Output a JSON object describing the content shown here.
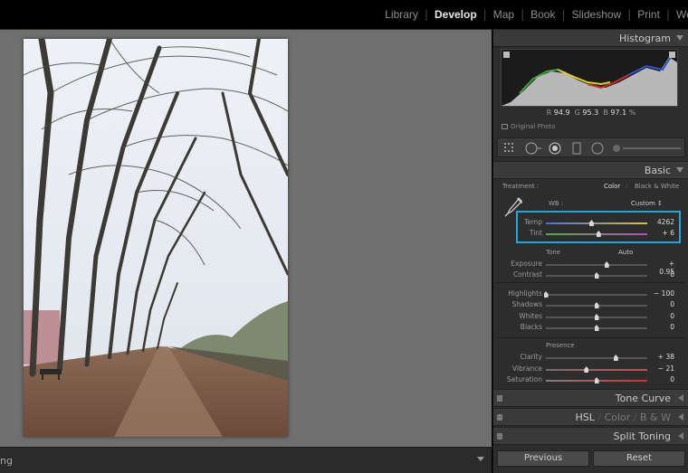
{
  "modules": [
    {
      "label": "Library",
      "active": false
    },
    {
      "label": "Develop",
      "active": true
    },
    {
      "label": "Map",
      "active": false
    },
    {
      "label": "Book",
      "active": false
    },
    {
      "label": "Slideshow",
      "active": false
    },
    {
      "label": "Print",
      "active": false
    },
    {
      "label": "Web",
      "active": false
    }
  ],
  "bottombar": {
    "label": "ng"
  },
  "histogram": {
    "title": "Histogram",
    "r_label": "R",
    "r_value": "94.9",
    "g_label": "G",
    "g_value": "95.3",
    "b_label": "B",
    "b_value": "97.1",
    "unit": "%",
    "original_photo_label": "Original Photo"
  },
  "basic": {
    "title": "Basic",
    "treatment_label": "Treatment :",
    "color_label": "Color",
    "bw_label": "Black & White",
    "wb_label": "WB :",
    "wb_value": "Custom ↕",
    "tone_label": "Tone",
    "auto_label": "Auto",
    "presence_label": "Presence",
    "sliders": [
      {
        "key": "temp",
        "label": "Temp",
        "value": "4262",
        "pos": 0.45,
        "track": "temp"
      },
      {
        "key": "tint",
        "label": "Tint",
        "value": "+ 6",
        "pos": 0.52,
        "track": "tint"
      },
      {
        "key": "exposure",
        "label": "Exposure",
        "value": "+ 0.95",
        "pos": 0.6
      },
      {
        "key": "contrast",
        "label": "Contrast",
        "value": "0",
        "pos": 0.5
      },
      {
        "key": "highlights",
        "label": "Highlights",
        "value": "− 100",
        "pos": 0.0
      },
      {
        "key": "shadows",
        "label": "Shadows",
        "value": "0",
        "pos": 0.5
      },
      {
        "key": "whites",
        "label": "Whites",
        "value": "0",
        "pos": 0.5
      },
      {
        "key": "blacks",
        "label": "Blacks",
        "value": "0",
        "pos": 0.5
      },
      {
        "key": "clarity",
        "label": "Clarity",
        "value": "+ 38",
        "pos": 0.69
      },
      {
        "key": "vibrance",
        "label": "Vibrance",
        "value": "− 21",
        "pos": 0.4,
        "track": "vib"
      },
      {
        "key": "saturation",
        "label": "Saturation",
        "value": "0",
        "pos": 0.5,
        "track": "sat"
      }
    ]
  },
  "panels": {
    "tone_curve": "Tone Curve",
    "hsl": "HSL",
    "color": "Color",
    "bw": "B & W",
    "split_toning": "Split Toning"
  },
  "buttons": {
    "previous": "Previous",
    "reset": "Reset"
  },
  "colors": {
    "highlight": "#1fa8e0",
    "panel": "#2d2d2d",
    "work_area": "#6f6f6f"
  }
}
